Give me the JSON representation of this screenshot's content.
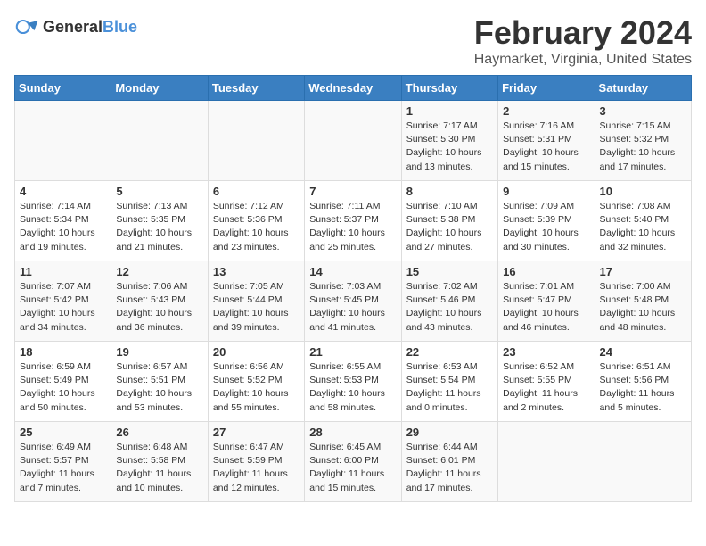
{
  "header": {
    "logo_general": "General",
    "logo_blue": "Blue",
    "month_year": "February 2024",
    "location": "Haymarket, Virginia, United States"
  },
  "weekdays": [
    "Sunday",
    "Monday",
    "Tuesday",
    "Wednesday",
    "Thursday",
    "Friday",
    "Saturday"
  ],
  "weeks": [
    [
      {
        "day": "",
        "info": ""
      },
      {
        "day": "",
        "info": ""
      },
      {
        "day": "",
        "info": ""
      },
      {
        "day": "",
        "info": ""
      },
      {
        "day": "1",
        "info": "Sunrise: 7:17 AM\nSunset: 5:30 PM\nDaylight: 10 hours\nand 13 minutes."
      },
      {
        "day": "2",
        "info": "Sunrise: 7:16 AM\nSunset: 5:31 PM\nDaylight: 10 hours\nand 15 minutes."
      },
      {
        "day": "3",
        "info": "Sunrise: 7:15 AM\nSunset: 5:32 PM\nDaylight: 10 hours\nand 17 minutes."
      }
    ],
    [
      {
        "day": "4",
        "info": "Sunrise: 7:14 AM\nSunset: 5:34 PM\nDaylight: 10 hours\nand 19 minutes."
      },
      {
        "day": "5",
        "info": "Sunrise: 7:13 AM\nSunset: 5:35 PM\nDaylight: 10 hours\nand 21 minutes."
      },
      {
        "day": "6",
        "info": "Sunrise: 7:12 AM\nSunset: 5:36 PM\nDaylight: 10 hours\nand 23 minutes."
      },
      {
        "day": "7",
        "info": "Sunrise: 7:11 AM\nSunset: 5:37 PM\nDaylight: 10 hours\nand 25 minutes."
      },
      {
        "day": "8",
        "info": "Sunrise: 7:10 AM\nSunset: 5:38 PM\nDaylight: 10 hours\nand 27 minutes."
      },
      {
        "day": "9",
        "info": "Sunrise: 7:09 AM\nSunset: 5:39 PM\nDaylight: 10 hours\nand 30 minutes."
      },
      {
        "day": "10",
        "info": "Sunrise: 7:08 AM\nSunset: 5:40 PM\nDaylight: 10 hours\nand 32 minutes."
      }
    ],
    [
      {
        "day": "11",
        "info": "Sunrise: 7:07 AM\nSunset: 5:42 PM\nDaylight: 10 hours\nand 34 minutes."
      },
      {
        "day": "12",
        "info": "Sunrise: 7:06 AM\nSunset: 5:43 PM\nDaylight: 10 hours\nand 36 minutes."
      },
      {
        "day": "13",
        "info": "Sunrise: 7:05 AM\nSunset: 5:44 PM\nDaylight: 10 hours\nand 39 minutes."
      },
      {
        "day": "14",
        "info": "Sunrise: 7:03 AM\nSunset: 5:45 PM\nDaylight: 10 hours\nand 41 minutes."
      },
      {
        "day": "15",
        "info": "Sunrise: 7:02 AM\nSunset: 5:46 PM\nDaylight: 10 hours\nand 43 minutes."
      },
      {
        "day": "16",
        "info": "Sunrise: 7:01 AM\nSunset: 5:47 PM\nDaylight: 10 hours\nand 46 minutes."
      },
      {
        "day": "17",
        "info": "Sunrise: 7:00 AM\nSunset: 5:48 PM\nDaylight: 10 hours\nand 48 minutes."
      }
    ],
    [
      {
        "day": "18",
        "info": "Sunrise: 6:59 AM\nSunset: 5:49 PM\nDaylight: 10 hours\nand 50 minutes."
      },
      {
        "day": "19",
        "info": "Sunrise: 6:57 AM\nSunset: 5:51 PM\nDaylight: 10 hours\nand 53 minutes."
      },
      {
        "day": "20",
        "info": "Sunrise: 6:56 AM\nSunset: 5:52 PM\nDaylight: 10 hours\nand 55 minutes."
      },
      {
        "day": "21",
        "info": "Sunrise: 6:55 AM\nSunset: 5:53 PM\nDaylight: 10 hours\nand 58 minutes."
      },
      {
        "day": "22",
        "info": "Sunrise: 6:53 AM\nSunset: 5:54 PM\nDaylight: 11 hours\nand 0 minutes."
      },
      {
        "day": "23",
        "info": "Sunrise: 6:52 AM\nSunset: 5:55 PM\nDaylight: 11 hours\nand 2 minutes."
      },
      {
        "day": "24",
        "info": "Sunrise: 6:51 AM\nSunset: 5:56 PM\nDaylight: 11 hours\nand 5 minutes."
      }
    ],
    [
      {
        "day": "25",
        "info": "Sunrise: 6:49 AM\nSunset: 5:57 PM\nDaylight: 11 hours\nand 7 minutes."
      },
      {
        "day": "26",
        "info": "Sunrise: 6:48 AM\nSunset: 5:58 PM\nDaylight: 11 hours\nand 10 minutes."
      },
      {
        "day": "27",
        "info": "Sunrise: 6:47 AM\nSunset: 5:59 PM\nDaylight: 11 hours\nand 12 minutes."
      },
      {
        "day": "28",
        "info": "Sunrise: 6:45 AM\nSunset: 6:00 PM\nDaylight: 11 hours\nand 15 minutes."
      },
      {
        "day": "29",
        "info": "Sunrise: 6:44 AM\nSunset: 6:01 PM\nDaylight: 11 hours\nand 17 minutes."
      },
      {
        "day": "",
        "info": ""
      },
      {
        "day": "",
        "info": ""
      }
    ]
  ]
}
